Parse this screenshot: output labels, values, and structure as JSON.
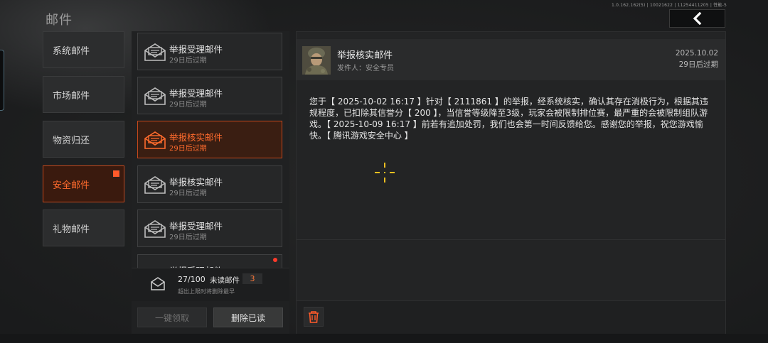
{
  "header": {
    "title": "邮件",
    "version": "1.0.162.162(5) | 10021622 | 11254411205 | 性能-5"
  },
  "categories": [
    {
      "label": "系统邮件",
      "active": false
    },
    {
      "label": "市场邮件",
      "active": false
    },
    {
      "label": "物资归还",
      "active": false
    },
    {
      "label": "安全邮件",
      "active": true
    },
    {
      "label": "礼物邮件",
      "active": false
    }
  ],
  "mails": [
    {
      "title": "举报受理邮件",
      "expire": "29日后过期"
    },
    {
      "title": "举报受理邮件",
      "expire": "29日后过期"
    },
    {
      "title": "举报核实邮件",
      "expire": "29日后过期"
    },
    {
      "title": "举报核实邮件",
      "expire": "29日后过期"
    },
    {
      "title": "举报受理邮件",
      "expire": "29日后过期"
    },
    {
      "title": "举报受理邮件",
      "expire": ""
    }
  ],
  "mail_counter": {
    "count": "27/100",
    "unread_label": "未读邮件",
    "unread_count": "3",
    "note": "超出上限时将删除最早"
  },
  "buttons": {
    "claim_all": "一键领取",
    "delete_read": "删除已读"
  },
  "detail": {
    "title": "举报核实邮件",
    "sender": "发件人：安全专员",
    "date": "2025.10.02",
    "expire": "29日后过期",
    "body": "您于【 2025-10-02 16:17 】针对【 2111861 】的举报，经系统核实，确认其存在消极行为，根据其违规程度，已扣除其信誉分【 200 】，当信誉等级降至3级，玩家会被限制排位赛，最严重的会被限制组队游戏。【 2025-10-09 16:17 】前若有追加处罚，我们也会第一时间反馈给您。感谢您的举报，祝您游戏愉快。【 腾讯游戏安全中心 】"
  },
  "colors": {
    "accent": "#ff6b2d",
    "panel": "#262728",
    "background": "#1b1c1d"
  }
}
